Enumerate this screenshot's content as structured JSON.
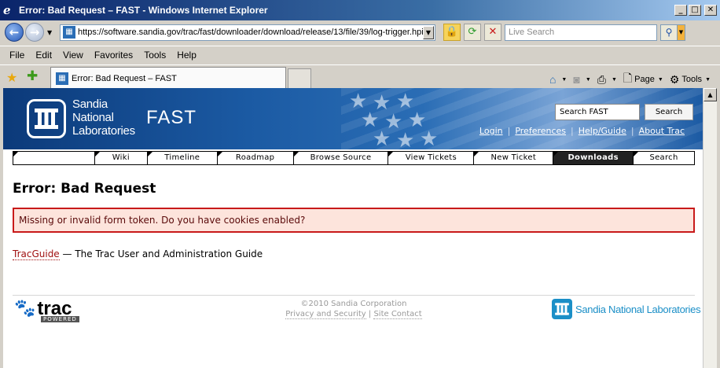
{
  "window": {
    "title": "Error: Bad Request – FAST - Windows Internet Explorer"
  },
  "toolbar": {
    "url": "https://software.sandia.gov/trac/fast/downloader/download/release/13/file/39/log-trigger.hpi",
    "search_placeholder": "Live Search"
  },
  "menu": [
    "File",
    "Edit",
    "View",
    "Favorites",
    "Tools",
    "Help"
  ],
  "tab": {
    "label": "Error: Bad Request – FAST"
  },
  "commandbar": {
    "page": "Page",
    "tools": "Tools"
  },
  "site": {
    "org_line1": "Sandia",
    "org_line2": "National",
    "org_line3": "Laboratories",
    "project": "FAST",
    "search_value": "Search FAST",
    "search_button": "Search",
    "metanav": [
      "Login",
      "Preferences",
      "Help/Guide",
      "About Trac"
    ]
  },
  "mainnav": [
    "",
    "Wiki",
    "Timeline",
    "Roadmap",
    "Browse Source",
    "View Tickets",
    "New Ticket",
    "Downloads",
    "Search"
  ],
  "content": {
    "heading": "Error: Bad Request",
    "error": "Missing or invalid form token. Do you have cookies enabled?",
    "guide_link": "TracGuide",
    "guide_rest": " — The Trac User and Administration Guide"
  },
  "footer": {
    "trac": "trac",
    "powered": "POWERED",
    "copyright": "©2010 Sandia Corporation",
    "privacy": "Privacy and Security",
    "contact": "Site Contact",
    "sandia": "Sandia National Laboratories"
  }
}
